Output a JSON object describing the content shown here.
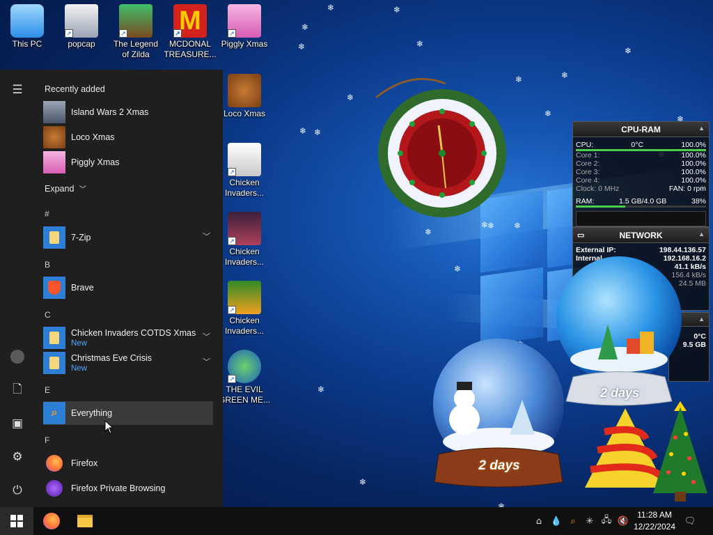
{
  "desktop": {
    "icons": [
      {
        "label": "This PC",
        "icon": "computer-icon"
      },
      {
        "label": "popcap",
        "icon": "popcap-icon"
      },
      {
        "label": "The Legend of Zilda",
        "icon": "zilda-game-icon"
      },
      {
        "label": "MCDONAL TREASURE...",
        "icon": "mcdonald-icon"
      },
      {
        "label": "Piggly Xmas",
        "icon": "piggly-icon"
      },
      {
        "label": "Loco Xmas",
        "icon": "loco-bear-icon"
      },
      {
        "label": "Chicken Invaders...",
        "icon": "chicken-icon"
      },
      {
        "label": "Chicken Invaders...",
        "icon": "chicken-icon"
      },
      {
        "label": "Chicken Invaders...",
        "icon": "chicken-icon"
      },
      {
        "label": "THE EVIL GREEN ME...",
        "icon": "evil-green-icon"
      }
    ]
  },
  "start_menu": {
    "recently_added_title": "Recently added",
    "recent": [
      {
        "label": "Island Wars 2 Xmas",
        "icon": "island-wars-icon"
      },
      {
        "label": "Loco Xmas",
        "icon": "loco-bear-icon"
      },
      {
        "label": "Piggly Xmas",
        "icon": "piggly-icon"
      }
    ],
    "expand_label": "Expand",
    "sections": [
      {
        "letter": "#",
        "apps": [
          {
            "label": "7-Zip",
            "sub": "",
            "icon": "folder-icon",
            "expandable": true
          }
        ]
      },
      {
        "letter": "B",
        "apps": [
          {
            "label": "Brave",
            "sub": "",
            "icon": "brave-icon",
            "expandable": false
          }
        ]
      },
      {
        "letter": "C",
        "apps": [
          {
            "label": "Chicken Invaders COTDS Xmas",
            "sub": "New",
            "icon": "folder-icon",
            "expandable": true
          },
          {
            "label": "Christmas Eve Crisis",
            "sub": "New",
            "icon": "folder-icon",
            "expandable": true
          }
        ]
      },
      {
        "letter": "E",
        "apps": [
          {
            "label": "Everything",
            "sub": "",
            "icon": "search-icon",
            "expandable": false
          }
        ]
      },
      {
        "letter": "F",
        "apps": [
          {
            "label": "Firefox",
            "sub": "",
            "icon": "firefox-icon",
            "expandable": false
          },
          {
            "label": "Firefox Private Browsing",
            "sub": "",
            "icon": "firefox-private-icon",
            "expandable": false
          }
        ]
      }
    ]
  },
  "cpu_widget": {
    "title": "CPU-RAM",
    "cpu_label": "CPU:",
    "cpu_temp": "0°C",
    "cpu_pct": "100.0%",
    "cores": [
      {
        "label": "Core 1:",
        "value": "100.0%"
      },
      {
        "label": "Core 2:",
        "value": "100.0%"
      },
      {
        "label": "Core 3:",
        "value": "100.0%"
      },
      {
        "label": "Core 4:",
        "value": "100.0%"
      }
    ],
    "clock": "Clock: 0 MHz",
    "fan": "FAN: 0 rpm",
    "ram_label": "RAM:",
    "ram_value": "1.5 GB/4.0 GB",
    "ram_pct": "38%",
    "ram_fraction": 0.38
  },
  "net_widget": {
    "title": "NETWORK",
    "ext_label": "External IP:",
    "ext_ip": "198.44.136.57",
    "int_label": "Internal",
    "int_ip": "192.168.16.2",
    "up_rate": "41.1 kB/s",
    "down_rate": "156.4 kB/s",
    "total": "24.5 MB"
  },
  "third_widget": {
    "temp": "0°C",
    "size": "9.5 GB"
  },
  "snowglobes": [
    {
      "label": "2 days"
    },
    {
      "label": "2 days"
    }
  ],
  "taskbar": {
    "time": "11:28 AM",
    "date": "12/22/2024"
  },
  "colors": {
    "accent": "#2d7fd6",
    "new_badge": "#4ea6ff",
    "taskbar": "#101010"
  }
}
